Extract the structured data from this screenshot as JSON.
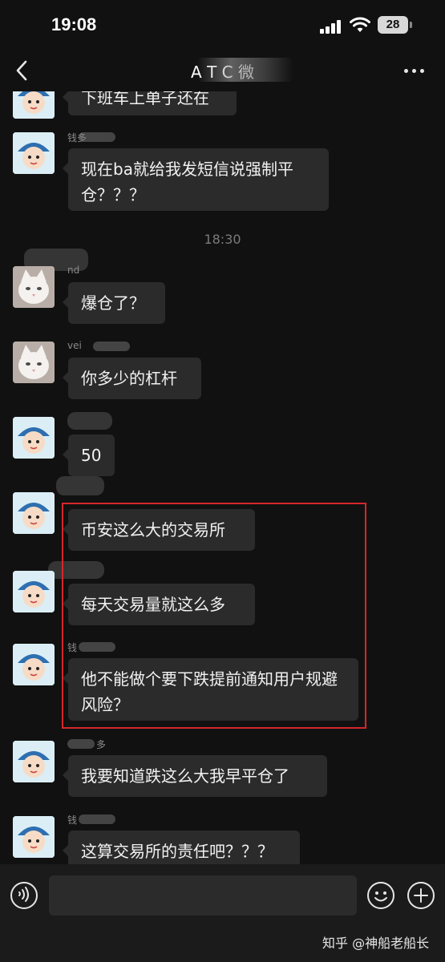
{
  "status_bar": {
    "time": "19:08",
    "battery_level": "28",
    "signal_icon": "signal-bars-icon",
    "wifi_icon": "wifi-icon"
  },
  "nav": {
    "title": "A T C 微",
    "back_icon": "chevron-left-icon",
    "more_icon": "more-dots-icon"
  },
  "messages": [
    {
      "sender": "",
      "text": "下班车上单子还在",
      "avatar": "cartoon-girl"
    },
    {
      "sender": "钱多",
      "text": "现在ba就给我发短信说强制平仓？？？",
      "avatar": "cartoon-girl"
    },
    {
      "timestamp": "18:30"
    },
    {
      "sender": "nd",
      "text": "爆仓了？",
      "avatar": "white-cat"
    },
    {
      "sender": "vei",
      "text": "你多少的杠杆",
      "avatar": "white-cat"
    },
    {
      "sender": "",
      "text": "50",
      "avatar": "cartoon-girl"
    },
    {
      "sender": "",
      "text": "币安这么大的交易所",
      "avatar": "cartoon-girl"
    },
    {
      "sender": "",
      "text": "每天交易量就这么多",
      "avatar": "cartoon-girl"
    },
    {
      "sender": "钱",
      "text": "他不能做个要下跌提前通知用户规避风险？",
      "avatar": "cartoon-girl"
    },
    {
      "sender": "多",
      "text": "我要知道跌这么大我早平仓了",
      "avatar": "cartoon-girl"
    },
    {
      "sender": "钱",
      "text": "这算交易所的责任吧？？？",
      "avatar": "cartoon-girl"
    }
  ],
  "highlight_color": "#d6272c",
  "input_bar": {
    "value": "",
    "voice_icon": "voice-icon",
    "emoji_icon": "emoji-icon",
    "plus_icon": "plus-icon"
  },
  "watermark": "知乎 @神船老船长"
}
